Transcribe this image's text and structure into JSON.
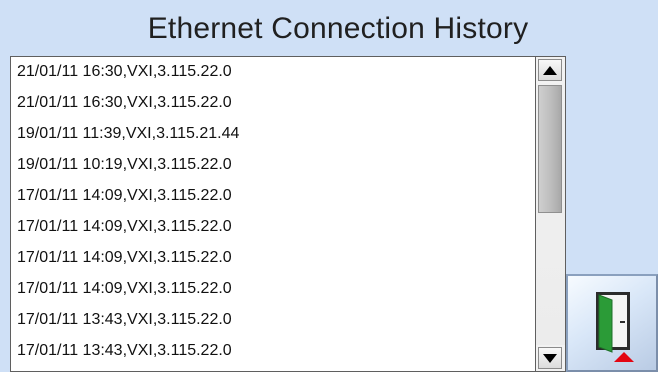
{
  "header": {
    "title": "Ethernet Connection History"
  },
  "history": {
    "entries": [
      "21/01/11 16:30,VXI,3.115.22.0",
      "21/01/11 16:30,VXI,3.115.22.0",
      "19/01/11 11:39,VXI,3.115.21.44",
      "19/01/11 10:19,VXI,3.115.22.0",
      "17/01/11 14:09,VXI,3.115.22.0",
      "17/01/11 14:09,VXI,3.115.22.0",
      "17/01/11 14:09,VXI,3.115.22.0",
      "17/01/11 14:09,VXI,3.115.22.0",
      "17/01/11 13:43,VXI,3.115.22.0",
      "17/01/11 13:43,VXI,3.115.22.0"
    ]
  },
  "scrollbar": {
    "up_icon": "arrow-up-icon",
    "down_icon": "arrow-down-icon"
  },
  "actions": {
    "exit_icon": "exit-door-icon"
  }
}
